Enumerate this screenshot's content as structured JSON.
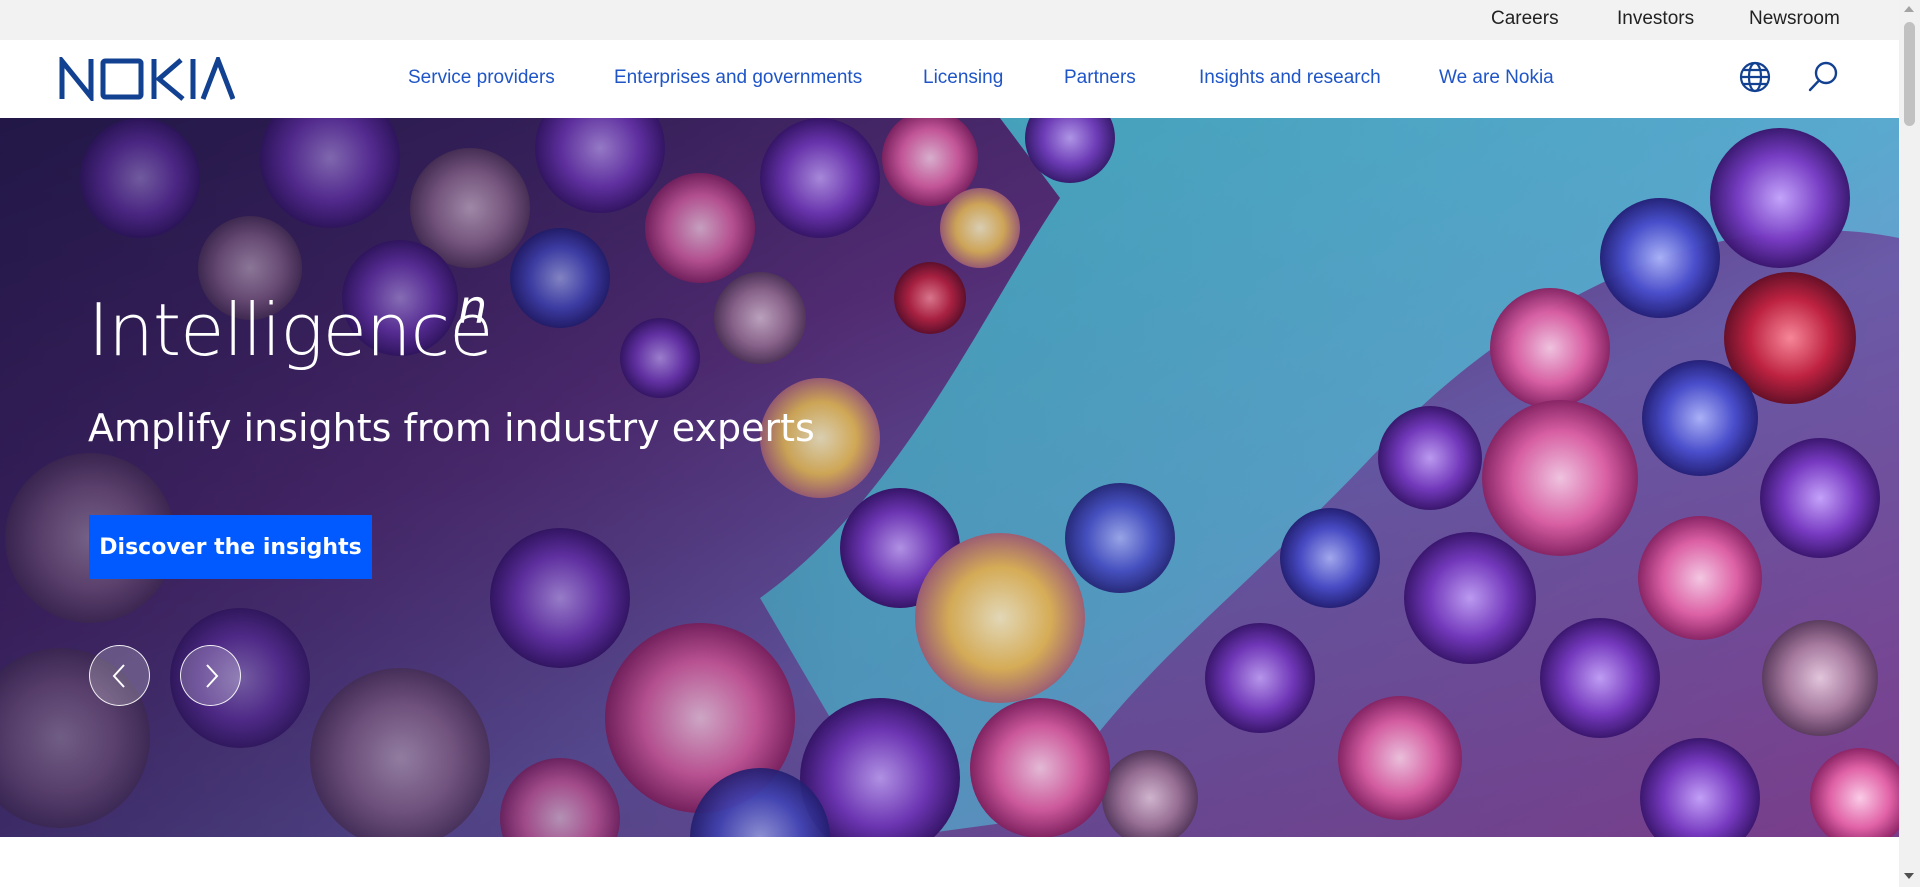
{
  "colors": {
    "brand_blue": "#124191",
    "nav_link": "#1f55c7",
    "cta_blue": "#005aff",
    "utility_bg": "#f2f2f2"
  },
  "utility_nav": {
    "items": [
      {
        "label": "Careers"
      },
      {
        "label": "Investors"
      },
      {
        "label": "Newsroom"
      }
    ]
  },
  "main_nav": {
    "logo_text": "NOKIA",
    "items": [
      {
        "label": "Service providers"
      },
      {
        "label": "Enterprises and governments"
      },
      {
        "label": "Licensing"
      },
      {
        "label": "Partners"
      },
      {
        "label": "Insights and research"
      },
      {
        "label": "We are Nokia"
      }
    ],
    "icons": {
      "language": "globe-icon",
      "search": "search-icon"
    }
  },
  "hero": {
    "title": "Intelligence",
    "title_superscript": "n",
    "subtitle": "Amplify insights from industry experts",
    "cta_label": "Discover the insights",
    "carousel": {
      "prev_icon": "chevron-left-icon",
      "next_icon": "chevron-right-icon"
    }
  }
}
